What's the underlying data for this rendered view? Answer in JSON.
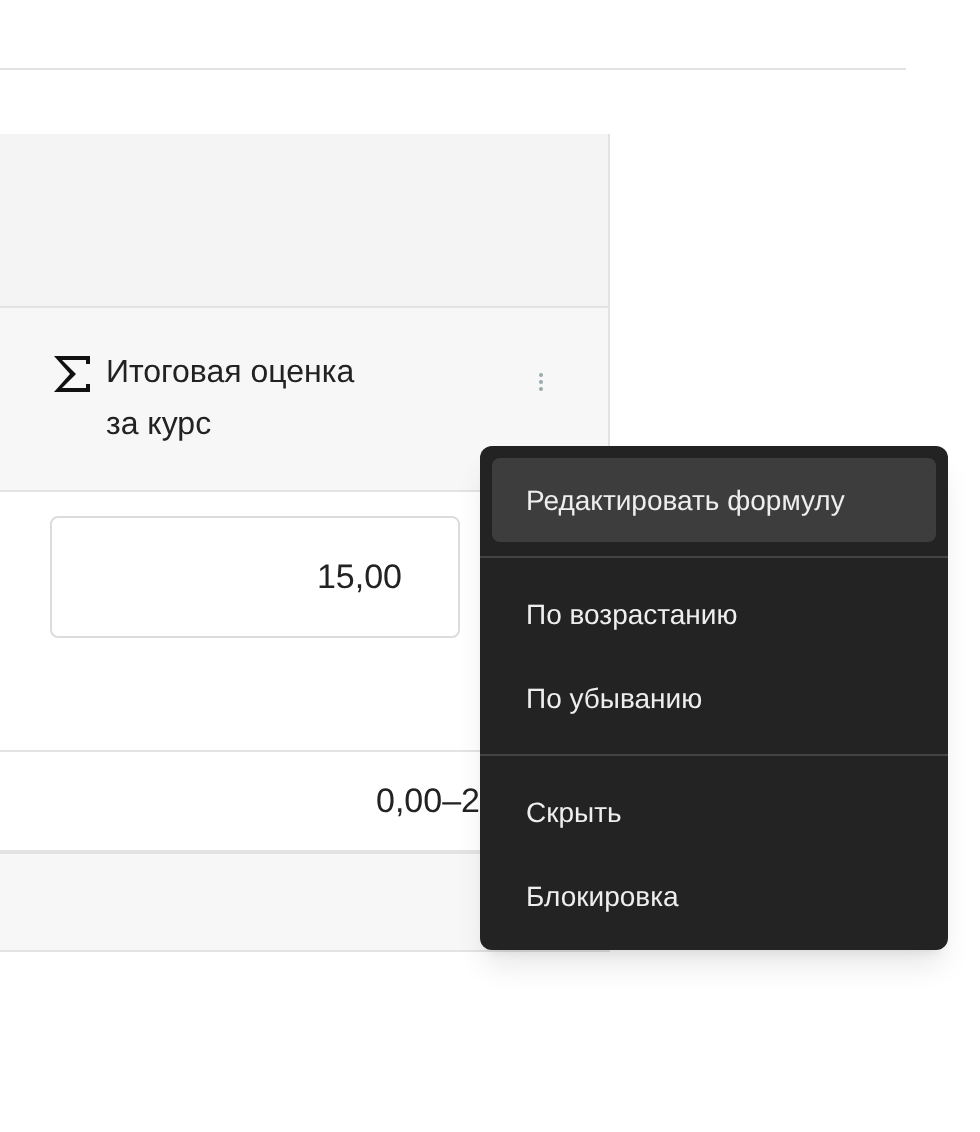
{
  "column_header": {
    "title": "Итоговая оценка за курс"
  },
  "grade_field": {
    "value": "15,00"
  },
  "range_cell": {
    "text": "0,00–2"
  },
  "menu_groups": [
    [
      {
        "label": "Редактировать формулу",
        "selected": true
      }
    ],
    [
      {
        "label": "По возрастанию",
        "selected": false
      },
      {
        "label": "По убыванию",
        "selected": false
      }
    ],
    [
      {
        "label": "Скрыть",
        "selected": false
      },
      {
        "label": "Блокировка",
        "selected": false
      }
    ]
  ]
}
